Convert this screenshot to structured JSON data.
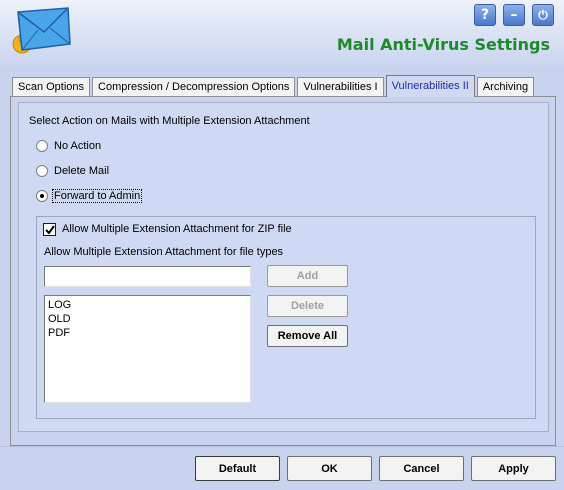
{
  "window": {
    "title": "Mail Anti-Virus Settings"
  },
  "header_buttons": {
    "help": "?",
    "minimize": "–",
    "power": "⏻"
  },
  "tabs": [
    {
      "label": "Scan Options",
      "active": false
    },
    {
      "label": "Compression / Decompression Options",
      "active": false
    },
    {
      "label": "Vulnerabilities I",
      "active": false
    },
    {
      "label": "Vulnerabilities II",
      "active": true
    },
    {
      "label": "Archiving",
      "active": false
    }
  ],
  "action": {
    "heading": "Select Action on Mails with Multiple Extension Attachment",
    "options": [
      {
        "label": "No Action",
        "selected": false
      },
      {
        "label": "Delete Mail",
        "selected": false
      },
      {
        "label": "Forward to Admin",
        "selected": true
      }
    ]
  },
  "zip": {
    "label": "Allow Multiple Extension Attachment for ZIP file",
    "checked": true
  },
  "file_types": {
    "heading": "Allow Multiple Extension Attachment for file types",
    "input_value": "",
    "items": [
      "LOG",
      "OLD",
      "PDF"
    ],
    "add_label": "Add",
    "delete_label": "Delete",
    "remove_all_label": "Remove All"
  },
  "footer": {
    "default_label": "Default",
    "ok_label": "OK",
    "cancel_label": "Cancel",
    "apply_label": "Apply"
  },
  "colors": {
    "title": "#1d8a2b",
    "active_tab_text": "#1a2ea0",
    "panel": "#cfd9f3"
  }
}
